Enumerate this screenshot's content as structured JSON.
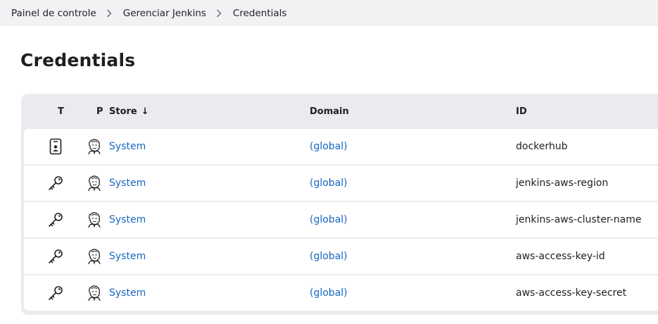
{
  "breadcrumb": {
    "items": [
      {
        "label": "Painel de controle"
      },
      {
        "label": "Gerenciar Jenkins"
      },
      {
        "label": "Credentials"
      }
    ]
  },
  "page": {
    "title": "Credentials"
  },
  "table": {
    "headers": {
      "type": "T",
      "provider": "P",
      "store": "Store",
      "store_sort": "↓",
      "domain": "Domain",
      "id": "ID"
    },
    "rows": [
      {
        "type_icon": "id-card-icon",
        "provider_icon": "jenkins-icon",
        "store": "System",
        "domain": "(global)",
        "id": "dockerhub"
      },
      {
        "type_icon": "key-icon",
        "provider_icon": "jenkins-icon",
        "store": "System",
        "domain": "(global)",
        "id": "jenkins-aws-region"
      },
      {
        "type_icon": "key-icon",
        "provider_icon": "jenkins-icon",
        "store": "System",
        "domain": "(global)",
        "id": "jenkins-aws-cluster-name"
      },
      {
        "type_icon": "key-icon",
        "provider_icon": "jenkins-icon",
        "store": "System",
        "domain": "(global)",
        "id": "aws-access-key-id"
      },
      {
        "type_icon": "key-icon",
        "provider_icon": "jenkins-icon",
        "store": "System",
        "domain": "(global)",
        "id": "aws-access-key-secret"
      }
    ]
  },
  "colors": {
    "link": "#1867c0",
    "text": "#1d1f21",
    "breadcrumb_bg": "#f2f2f5",
    "table_frame": "#ebebef"
  }
}
